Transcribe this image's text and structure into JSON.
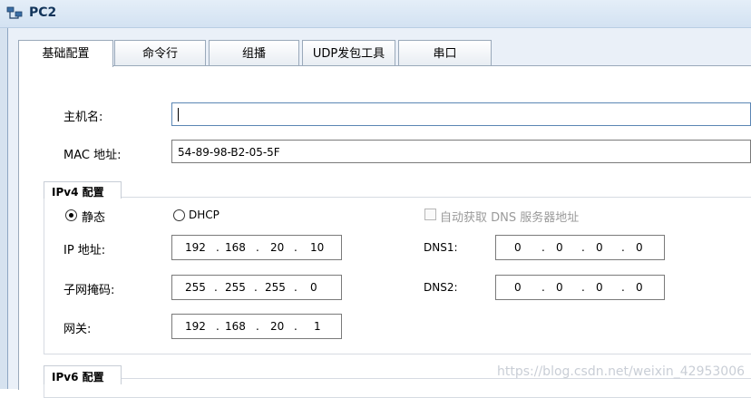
{
  "window": {
    "title": "PC2"
  },
  "tabs": [
    {
      "label": "基础配置"
    },
    {
      "label": "命令行"
    },
    {
      "label": "组播"
    },
    {
      "label": "UDP发包工具"
    },
    {
      "label": "串口"
    }
  ],
  "hostname": {
    "label": "主机名:",
    "value": ""
  },
  "mac": {
    "label": "MAC 地址:",
    "value": "54-89-98-B2-05-5F"
  },
  "ipv4": {
    "section_label": "IPv4 配置",
    "static_label": "静态",
    "dhcp_label": "DHCP",
    "auto_dns_label": "自动获取 DNS 服务器地址",
    "ip_label": "IP 地址:",
    "ip": [
      "192",
      "168",
      "20",
      "10"
    ],
    "mask_label": "子网掩码:",
    "mask": [
      "255",
      "255",
      "255",
      "0"
    ],
    "gateway_label": "网关:",
    "gateway": [
      "192",
      "168",
      "20",
      "1"
    ],
    "dns1_label": "DNS1:",
    "dns1": [
      "0",
      "0",
      "0",
      "0"
    ],
    "dns2_label": "DNS2:",
    "dns2": [
      "0",
      "0",
      "0",
      "0"
    ]
  },
  "ipv6": {
    "section_label": "IPv6 配置"
  },
  "watermark": "https://blog.csdn.net/weixin_42953006"
}
